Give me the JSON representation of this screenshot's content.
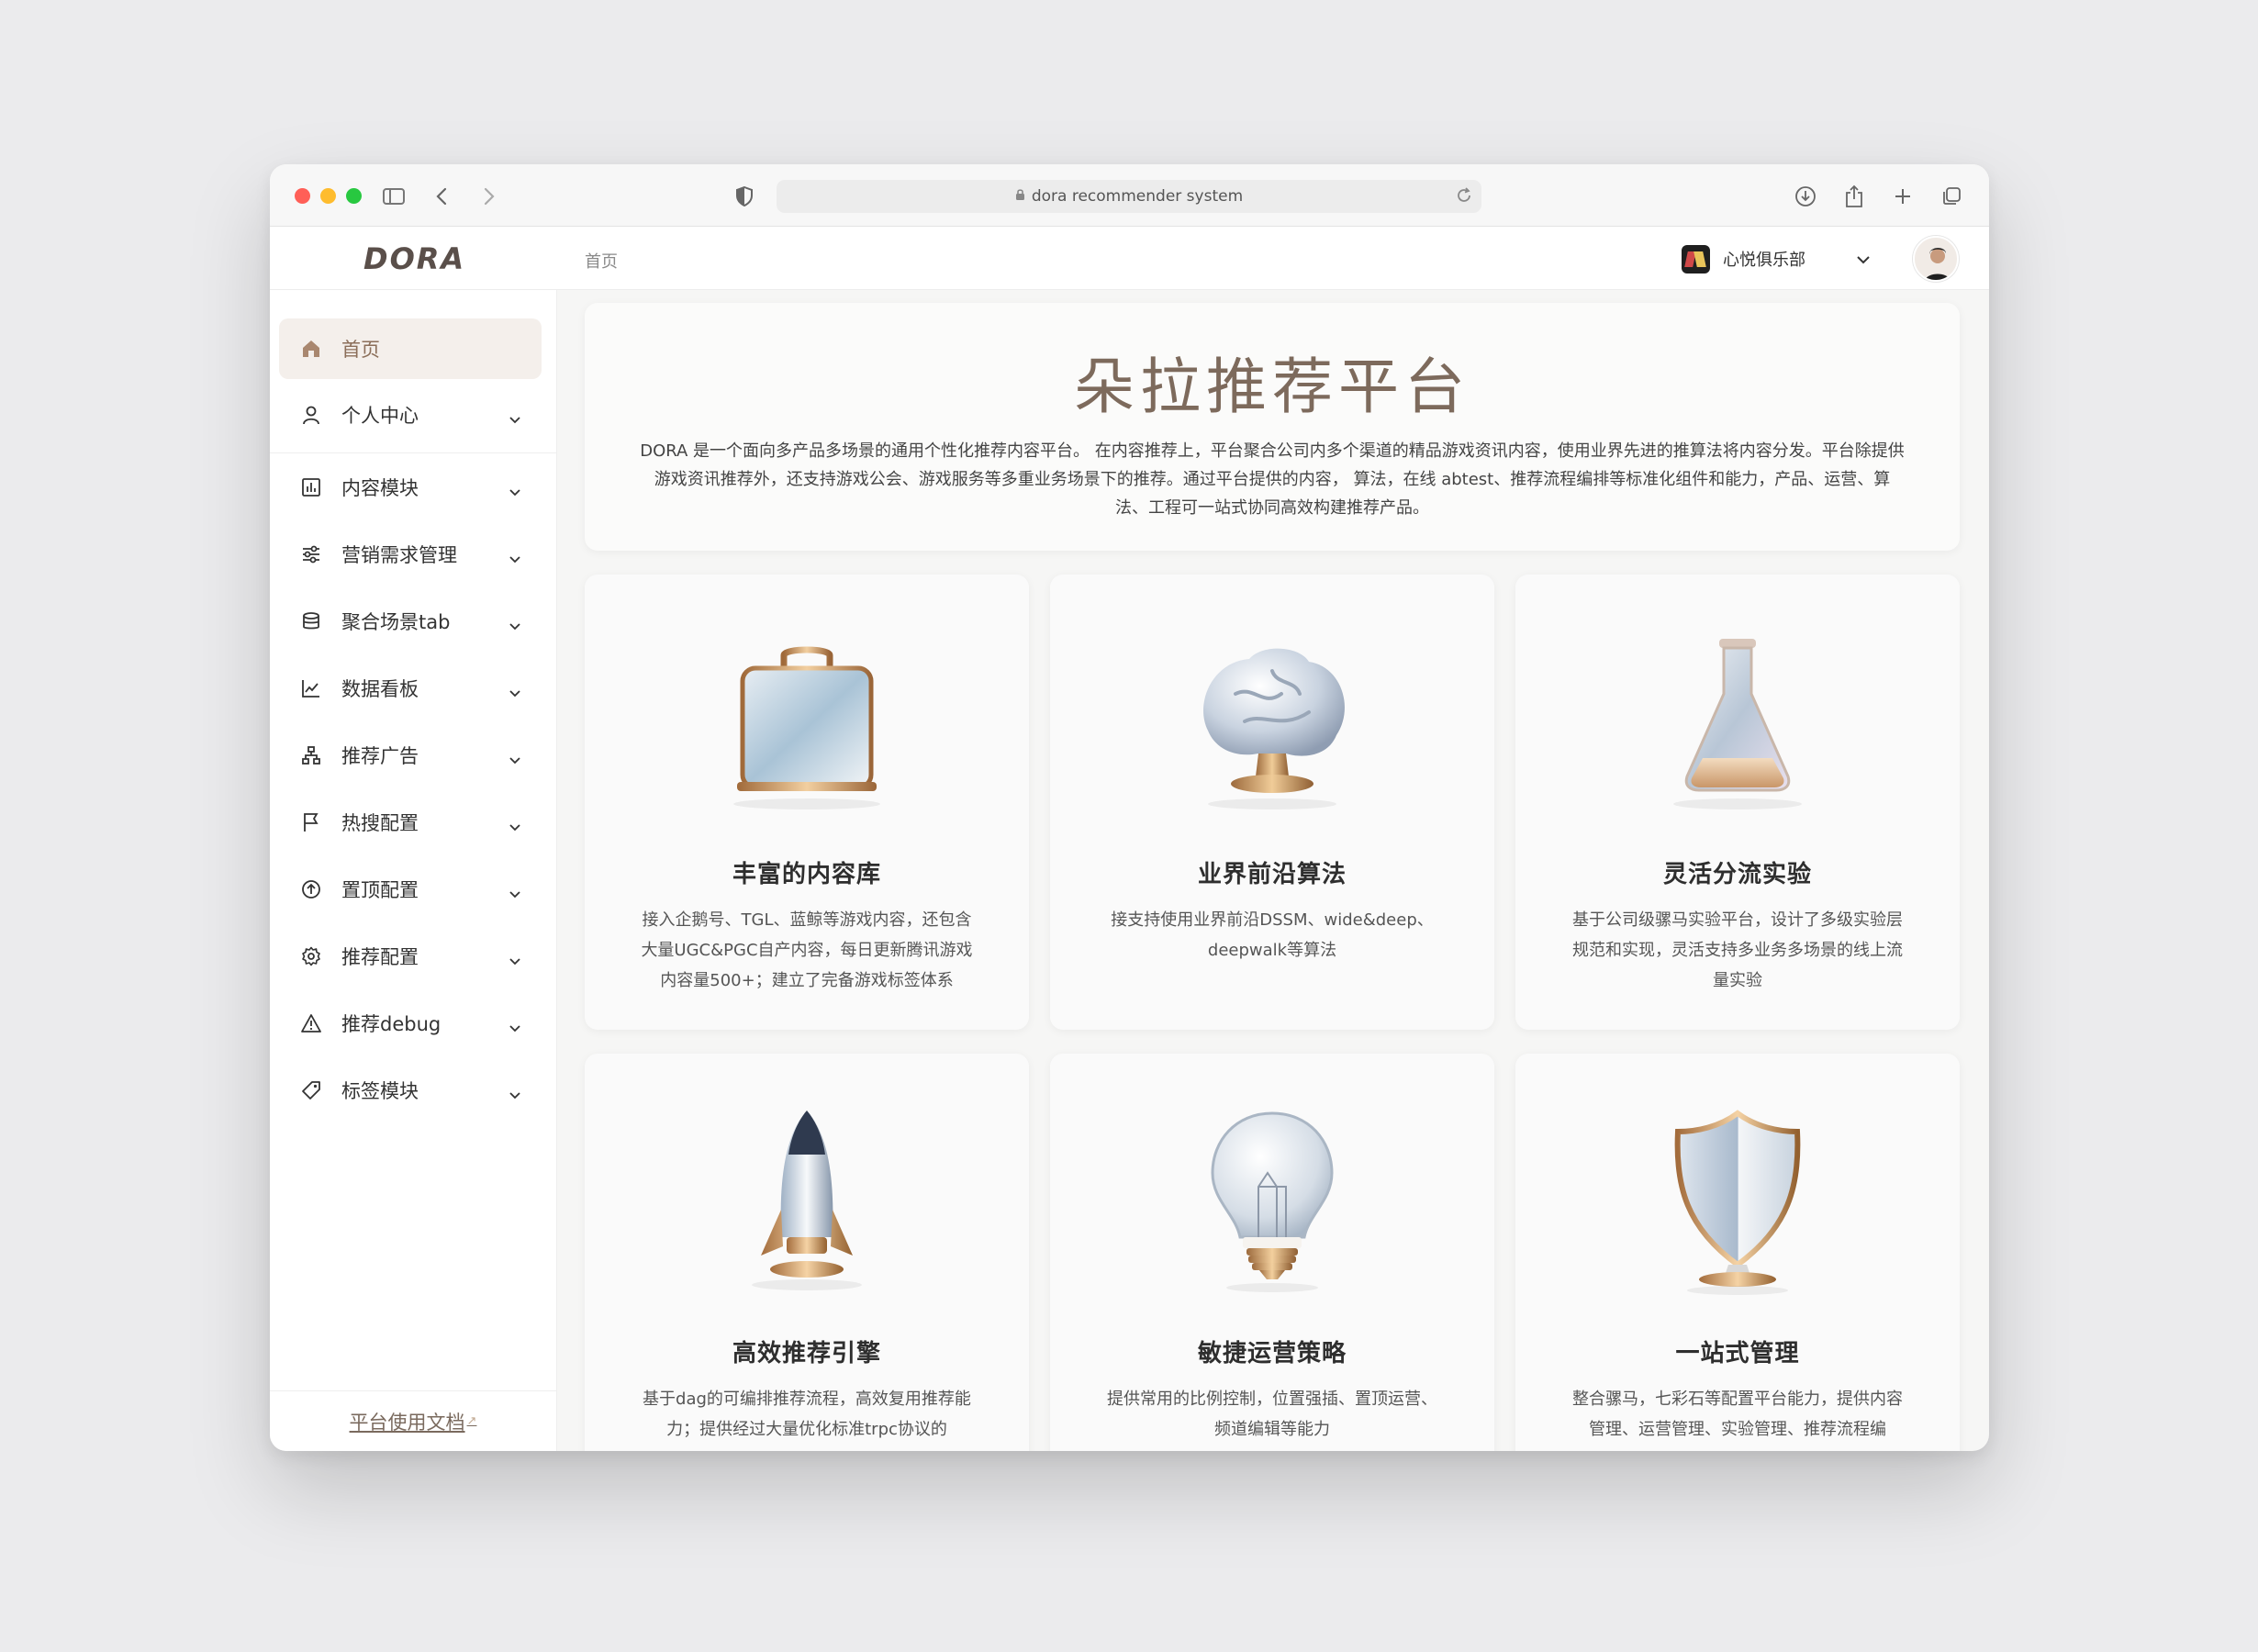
{
  "browser": {
    "url": "dora recommender system"
  },
  "app": {
    "logo": "DORA",
    "breadcrumb": "首页",
    "team_name": "心悦俱乐部"
  },
  "sidebar": {
    "items": [
      {
        "label": "首页",
        "icon": "home-icon"
      },
      {
        "label": "个人中心",
        "icon": "user-icon"
      },
      {
        "label": "内容模块",
        "icon": "chart-box-icon"
      },
      {
        "label": "营销需求管理",
        "icon": "sliders-icon"
      },
      {
        "label": "聚合场景tab",
        "icon": "database-icon"
      },
      {
        "label": "数据看板",
        "icon": "line-chart-icon"
      },
      {
        "label": "推荐广告",
        "icon": "network-icon"
      },
      {
        "label": "热搜配置",
        "icon": "flag-icon"
      },
      {
        "label": "置顶配置",
        "icon": "arrow-up-circle-icon"
      },
      {
        "label": "推荐配置",
        "icon": "gear-icon"
      },
      {
        "label": "推荐debug",
        "icon": "warning-icon"
      },
      {
        "label": "标签模块",
        "icon": "tag-icon"
      }
    ],
    "doc_link": "平台使用文档"
  },
  "hero": {
    "title": "朵拉推荐平台",
    "description": "DORA 是一个面向多产品多场景的通用个性化推荐内容平台。 在内容推荐上，平台聚合公司内多个渠道的精品游戏资讯内容，使用业界先进的推算法将内容分发。平台除提供游戏资讯推荐外，还支持游戏公会、游戏服务等多重业务场景下的推荐。通过平台提供的内容， 算法，在线 abtest、推荐流程编排等标准化组件和能力，产品、运营、算法、工程可一站式协同高效构建推荐产品。"
  },
  "cards": [
    {
      "title": "丰富的内容库",
      "desc": "接入企鹅号、TGL、蓝鲸等游戏内容，还包含大量UGC&PGC自产内容，每日更新腾讯游戏内容量500+；建立了完备游戏标签体系",
      "icon": "briefcase-icon"
    },
    {
      "title": "业界前沿算法",
      "desc": "接支持使用业界前沿DSSM、wide&deep、deepwalk等算法",
      "icon": "brain-icon"
    },
    {
      "title": "灵活分流实验",
      "desc": "基于公司级骡马实验平台，设计了多级实验层规范和实现，灵活支持多业务多场景的线上流量实验",
      "icon": "flask-icon"
    },
    {
      "title": "高效推荐引擎",
      "desc": "基于dag的可编排推荐流程，高效复用推荐能力；提供经过大量优化标准trpc协议的",
      "icon": "rocket-icon"
    },
    {
      "title": "敏捷运营策略",
      "desc": "提供常用的比例控制，位置强插、置顶运营、频道编辑等能力",
      "icon": "lightbulb-icon"
    },
    {
      "title": "一站式管理",
      "desc": "整合骡马，七彩石等配置平台能力，提供内容管理、运营管理、实验管理、推荐流程编",
      "icon": "shield-icon"
    }
  ],
  "colors": {
    "accent": "#8b6e59",
    "active_bg": "#f4efeb"
  }
}
